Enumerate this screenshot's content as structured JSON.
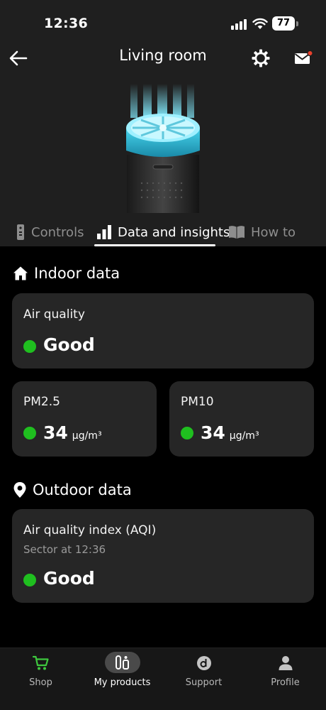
{
  "status_bar": {
    "time": "12:36",
    "battery": "77"
  },
  "header": {
    "title": "Living room"
  },
  "tabs": [
    {
      "label": "Controls"
    },
    {
      "label": "Data and insights"
    },
    {
      "label": "How to"
    }
  ],
  "indoor": {
    "title": "Indoor data",
    "air_quality": {
      "label": "Air quality",
      "value": "Good",
      "status_color": "#1fbf1f"
    },
    "pm25": {
      "label": "PM2.5",
      "value": "34",
      "unit": "µg/m³"
    },
    "pm10": {
      "label": "PM10",
      "value": "34",
      "unit": "µg/m³"
    }
  },
  "outdoor": {
    "title": "Outdoor data",
    "aqi": {
      "label": "Air quality index (AQI)",
      "sub": "Sector at 12:36",
      "value": "Good"
    }
  },
  "nav": [
    {
      "label": "Shop",
      "icon": "cart-icon"
    },
    {
      "label": "My products",
      "icon": "products-icon"
    },
    {
      "label": "Support",
      "icon": "support-icon"
    },
    {
      "label": "Profile",
      "icon": "profile-icon"
    }
  ],
  "colors": {
    "accent_green": "#1fbf1f",
    "notification_red": "#e8412c",
    "glow_cyan": "#3fc9e6"
  }
}
